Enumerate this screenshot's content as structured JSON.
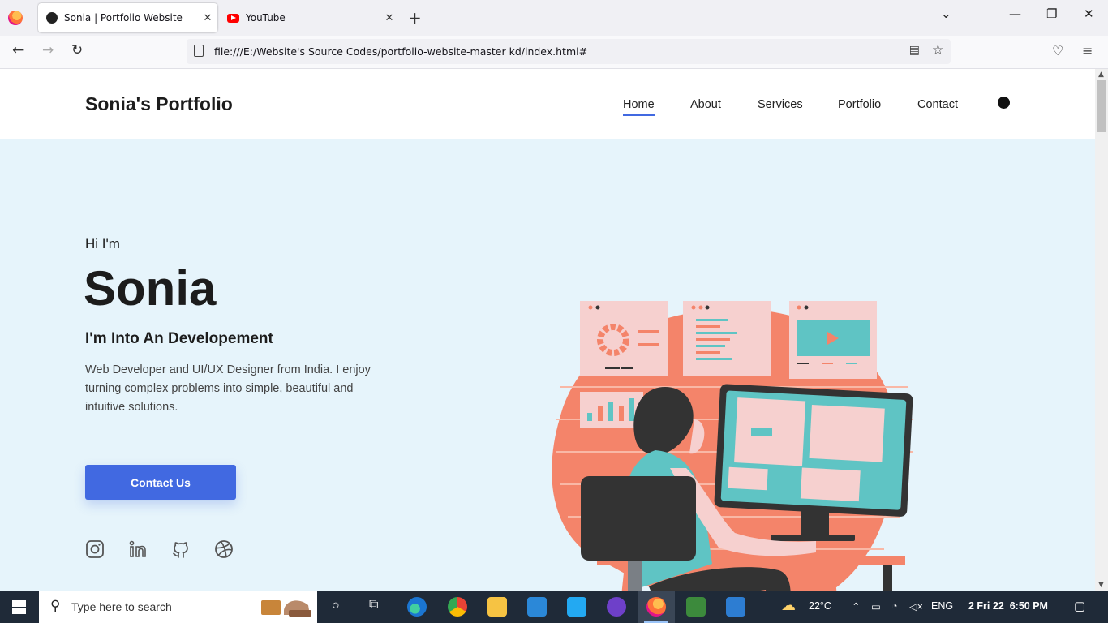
{
  "browser": {
    "tabs": [
      {
        "title": "Sonia | Portfolio Website",
        "active": true
      },
      {
        "title": "YouTube",
        "active": false
      }
    ],
    "url": "file:///E:/Website's Source Codes/portfolio-website-master kd/index.html#"
  },
  "site": {
    "logo": "Sonia's Portfolio",
    "nav": [
      "Home",
      "About",
      "Services",
      "Portfolio",
      "Contact"
    ],
    "active_nav": "Home",
    "hero": {
      "greeting": "Hi I'm",
      "name": "Sonia",
      "subtitle": "I'm Into An Developement",
      "description": "Web Developer and UI/UX Designer from India. I enjoy turning complex problems into simple, beautiful and intuitive solutions.",
      "cta": "Contact Us"
    },
    "social_icons": [
      "instagram-icon",
      "linkedin-icon",
      "github-icon",
      "dribbble-icon"
    ]
  },
  "taskbar": {
    "search_placeholder": "Type here to search",
    "weather": "22°C",
    "language": "ENG",
    "clock": "2 Fri 22  6:50 PM"
  },
  "colors": {
    "accent": "#4169e1",
    "hero_bg": "#e6f4fb",
    "illustration_orange": "#f4846a",
    "illustration_teal": "#5fc4c4"
  }
}
